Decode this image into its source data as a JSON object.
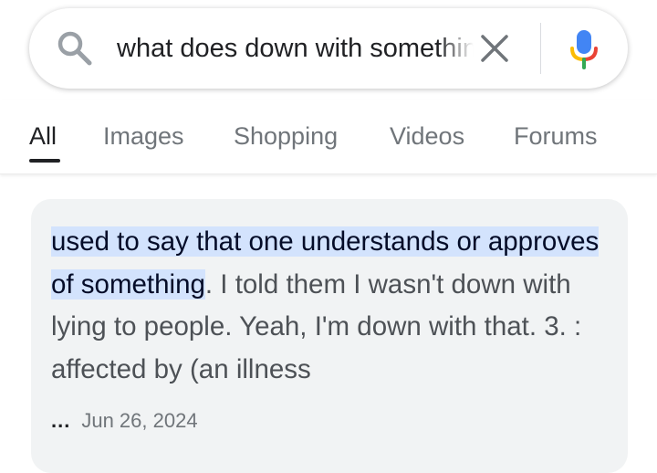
{
  "search": {
    "query": "what does down with something mean",
    "icons": {
      "search": "search-icon",
      "clear": "close-icon",
      "voice": "microphone-icon"
    }
  },
  "tabs": [
    {
      "label": "All",
      "active": true
    },
    {
      "label": "Images",
      "active": false
    },
    {
      "label": "Shopping",
      "active": false
    },
    {
      "label": "Videos",
      "active": false
    },
    {
      "label": "Forums",
      "active": false
    }
  ],
  "result": {
    "highlight": "used to say that one understands or approves of something",
    "rest": ". I told them I wasn't down with lying to people. Yeah, I'm down with that. 3. : affected by (an illness",
    "ellipsis": "...",
    "date": "Jun 26, 2024"
  },
  "colors": {
    "highlight_bg": "#d3e3fd",
    "card_bg": "#f1f3f4",
    "mic_blue": "#4285f4",
    "mic_red": "#ea4335",
    "mic_yellow": "#fbbc04",
    "mic_green": "#34a853"
  }
}
